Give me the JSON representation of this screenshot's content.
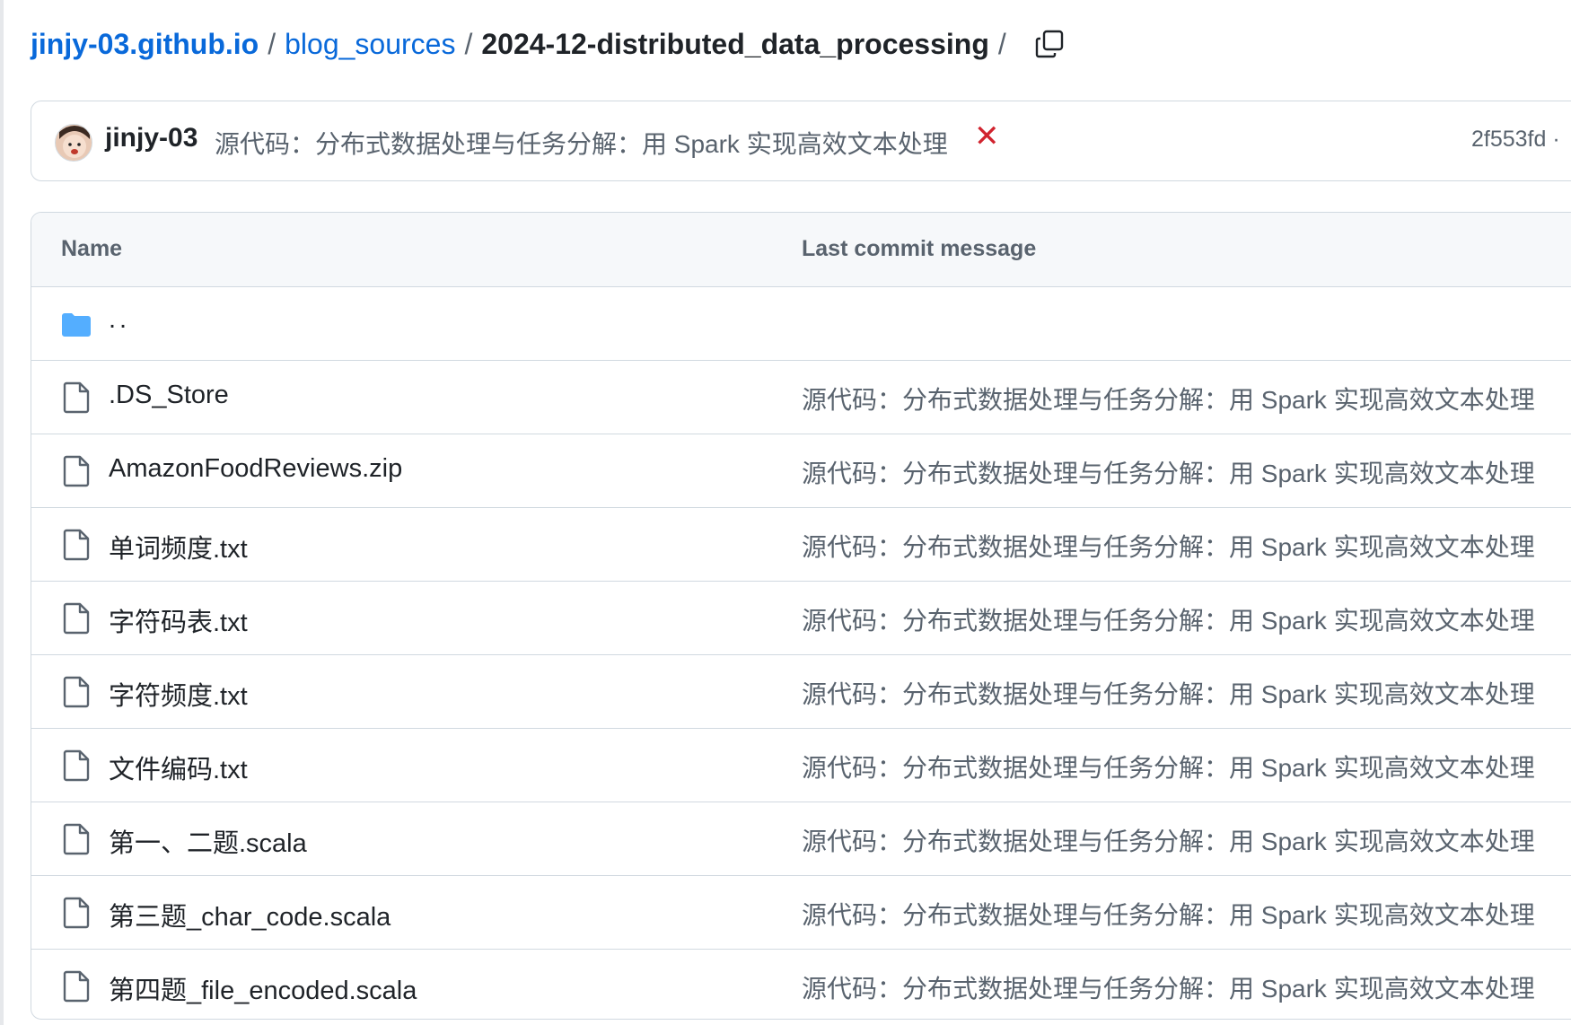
{
  "breadcrumb": {
    "repo": "jinjy-03.github.io",
    "folder": "blog_sources",
    "current": "2024-12-distributed_data_processing",
    "separator": "/",
    "copy_icon": "copy-icon"
  },
  "commit": {
    "author": "jinjy-03",
    "message": "源代码：分布式数据处理与任务分解：用 Spark 实现高效文本处理",
    "status_symbol": "✕",
    "status_color": "#d1242f",
    "hash": "2f553fd ·"
  },
  "table": {
    "headers": {
      "name": "Name",
      "message": "Last commit message"
    },
    "parent": {
      "name": "..",
      "icon": "folder-icon"
    },
    "rows": [
      {
        "name": ".DS_Store",
        "message": "源代码：分布式数据处理与任务分解：用 Spark 实现高效文本处理",
        "icon": "file-icon"
      },
      {
        "name": "AmazonFoodReviews.zip",
        "message": "源代码：分布式数据处理与任务分解：用 Spark 实现高效文本处理",
        "icon": "file-icon"
      },
      {
        "name": "单词频度.txt",
        "message": "源代码：分布式数据处理与任务分解：用 Spark 实现高效文本处理",
        "icon": "file-icon"
      },
      {
        "name": "字符码表.txt",
        "message": "源代码：分布式数据处理与任务分解：用 Spark 实现高效文本处理",
        "icon": "file-icon"
      },
      {
        "name": "字符频度.txt",
        "message": "源代码：分布式数据处理与任务分解：用 Spark 实现高效文本处理",
        "icon": "file-icon"
      },
      {
        "name": "文件编码.txt",
        "message": "源代码：分布式数据处理与任务分解：用 Spark 实现高效文本处理",
        "icon": "file-icon"
      },
      {
        "name": "第一、二题.scala",
        "message": "源代码：分布式数据处理与任务分解：用 Spark 实现高效文本处理",
        "icon": "file-icon"
      },
      {
        "name": "第三题_char_code.scala",
        "message": "源代码：分布式数据处理与任务分解：用 Spark 实现高效文本处理",
        "icon": "file-icon"
      },
      {
        "name": "第四题_file_encoded.scala",
        "message": "源代码：分布式数据处理与任务分解：用 Spark 实现高效文本处理",
        "icon": "file-icon"
      }
    ]
  },
  "colors": {
    "link": "#0969da",
    "text": "#1f2328",
    "muted": "#59636e",
    "border": "#d1d9e0",
    "header_bg": "#f6f8fa",
    "folder": "#54aeff"
  }
}
